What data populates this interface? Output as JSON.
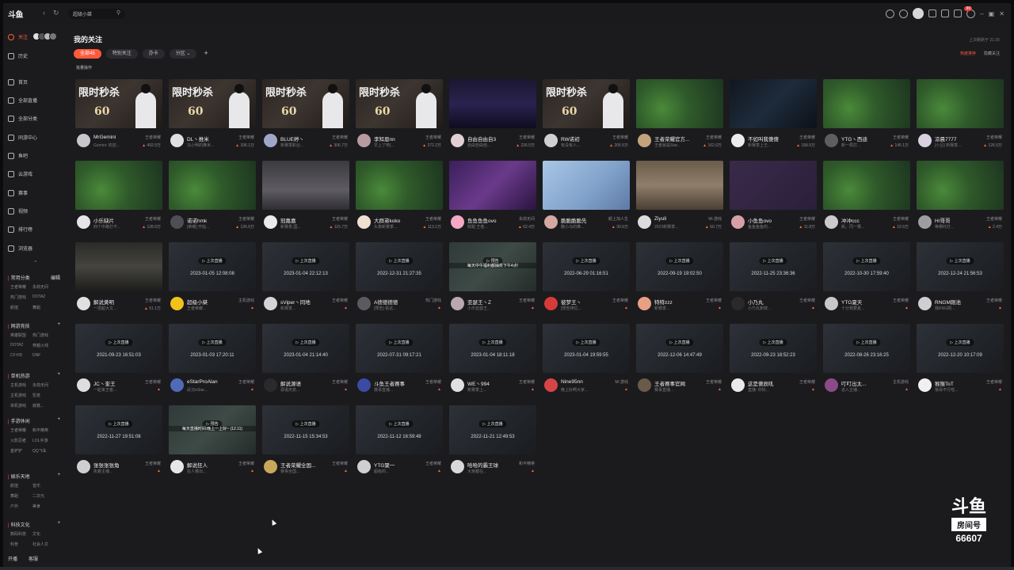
{
  "app": {
    "logo": "斗鱼",
    "search_value": "超级小桀",
    "notification_count": "99",
    "colors": {
      "accent": "#ff5a3c",
      "bg": "#1b1b1e",
      "card": "#2a2a2e"
    }
  },
  "sidebar": {
    "follow_label": "关注",
    "history_label": "历史",
    "nav": [
      "首页",
      "全部直播",
      "全部分类",
      "同游中心",
      "鱼吧",
      "云游戏",
      "赛事",
      "视频",
      "排行榜",
      "浏览器"
    ],
    "groups": [
      {
        "title": "常用分类",
        "action": "编辑",
        "items": [
          "王者荣耀",
          "永劫无间",
          "热门游戏",
          "DOTA2",
          "颜值",
          "舞蹈"
        ]
      },
      {
        "title": "网游竞技",
        "action": "+",
        "items": [
          "英雄联盟",
          "热门游戏",
          "DOTA2",
          "穿越火线",
          "CF:HD",
          "DNF"
        ]
      },
      {
        "title": "单机热游",
        "action": "+",
        "items": [
          "主机游戏",
          "永劫无间",
          "主机游戏",
          "饥荒",
          "单机游戏",
          "寂寞..."
        ]
      },
      {
        "title": "手游休闲",
        "action": "+",
        "items": [
          "王者荣耀",
          "和平精英",
          "火影忍者",
          "LOL手游",
          "金铲铲",
          "QQ飞车"
        ]
      },
      {
        "title": "娱乐天地",
        "action": "+",
        "items": [
          "颜值",
          "音乐",
          "舞蹈",
          "二次元",
          "户外",
          "美食"
        ]
      },
      {
        "title": "科技文化",
        "action": "+",
        "items": [
          "数码科技",
          "文化",
          "科普",
          "社会人文"
        ]
      }
    ],
    "bottom": [
      "开播",
      "客服"
    ]
  },
  "main": {
    "title": "我的关注",
    "tabs": [
      "全部45",
      "特别关注",
      "办卡",
      "分区"
    ],
    "batch_label": "批量操作",
    "updated": "上次刷新于 21:35",
    "link_hot": "热度排序",
    "link_hide": "隐藏关注",
    "promo_text": "限时秒杀",
    "promo_number": "60",
    "replay_label": "上次直播",
    "preview_label": "预告"
  },
  "cards": [
    {
      "name": "MrGemini",
      "cat": "王者荣耀",
      "sub": "Gemini: 欢迎...",
      "hot": "492.5万",
      "thumb": "promo",
      "av": "#c7c7cb"
    },
    {
      "name": "DL丶推米",
      "cat": "王者荣耀",
      "sub": "马小明的推米...",
      "hot": "336.1万",
      "thumb": "promo",
      "av": "#e0e0e2"
    },
    {
      "name": "BLUE婷丶",
      "cat": "王者荣耀",
      "sub": "新赛季职业...",
      "hot": "306.7万",
      "thumb": "promo",
      "av": "#9fa7c9"
    },
    {
      "name": "李知恩nn",
      "cat": "王者荣耀",
      "sub": "早上了吧(...",
      "hot": "272.2万",
      "thumb": "promo",
      "av": "#b89aa2"
    },
    {
      "name": "自由自由自3",
      "cat": "王者荣耀",
      "sub": "自由自由自...",
      "hot": "226.5万",
      "thumb": "game-dark",
      "av": "#e3cfd2"
    },
    {
      "name": "RW诺初",
      "cat": "王者荣耀",
      "sub": "有没有人...",
      "hot": "205.5万",
      "thumb": "promo",
      "av": "#d0d0d2"
    },
    {
      "name": "王者荣耀官方...",
      "cat": "王者荣耀",
      "sub": "王者就是Star...",
      "hot": "162.6万",
      "thumb": "moba",
      "av": "#c4a37c"
    },
    {
      "name": "不如叫我傻傻",
      "cat": "王者荣耀",
      "sub": "新赛季上王...",
      "hot": "158.5万",
      "thumb": "map",
      "av": "#ececec"
    },
    {
      "name": "YTG丶西迪",
      "cat": "王者荣耀",
      "sub": "新一局打...",
      "hot": "145.1万",
      "thumb": "moba",
      "av": "#5d5d62"
    },
    {
      "name": "凉晨7777",
      "cat": "王者荣耀",
      "sub": "[小吕] 新赛季...",
      "hot": "126.5万",
      "thumb": "moba",
      "av": "#d9d0e0"
    },
    {
      "name": "小乐缺片",
      "cat": "王者荣耀",
      "sub": "四个中路打不...",
      "hot": "128.6万",
      "thumb": "moba",
      "av": "#e5e5e7"
    },
    {
      "name": "诺诺hmk",
      "cat": "王者荣耀",
      "sub": "[荣耀] 开始...",
      "hot": "126.6万",
      "thumb": "moba",
      "av": "#4e4e55"
    },
    {
      "name": "冠嘉嘉",
      "cat": "王者荣耀",
      "sub": "新赛季,国...",
      "hot": "115.7万",
      "thumb": "desk",
      "av": "#eaeaea"
    },
    {
      "name": "大群弟koko",
      "cat": "王者荣耀",
      "sub": "头像新赛季...",
      "hot": "113.1万",
      "thumb": "moba",
      "av": "#f0e0d0"
    },
    {
      "name": "鱼鱼鱼鱼ovo",
      "cat": "永劫无间",
      "sub": "鲜甜 王者...",
      "hot": "62.4万",
      "thumb": "purple",
      "av": "#f5a7c4"
    },
    {
      "name": "脆脆脆脆先",
      "cat": "颜上加人生",
      "sub": "脆小马的推...",
      "hot": "30.6万",
      "thumb": "anime",
      "av": "#d6a8a2"
    },
    {
      "name": "Ziyuli",
      "cat": "Mi 游戏",
      "sub": "2023新赛季...",
      "hot": "50.7万",
      "thumb": "room",
      "av": "#dcdcdc"
    },
    {
      "name": "小鱼鱼ovo",
      "cat": "王者荣耀",
      "sub": "鱼鱼鱼鱼的...",
      "hot": "11.8万",
      "thumb": "grid",
      "av": "#d8a0a6"
    },
    {
      "name": "冲冲ccc",
      "cat": "王者荣耀",
      "sub": "新。同一赛...",
      "hot": "10.5万",
      "thumb": "moba",
      "av": "#cbcbcd"
    },
    {
      "name": "H/哥哥",
      "cat": "王者荣耀",
      "sub": "等哪吒打...",
      "hot": "2.4万",
      "thumb": "moba",
      "av": "#9d9da2"
    },
    {
      "name": "解说黄明",
      "cat": "王者荣耀",
      "sub": "一把超大文...",
      "hot": "51.1万",
      "thumb": "chess",
      "av": "#e0e0e0"
    },
    {
      "name": "超级小桀",
      "cat": "主机游戏",
      "sub": "王者荣耀...",
      "hot": "",
      "thumb": "replay",
      "ts": "2023-01-05 12:08:08",
      "av": "#f2c21b"
    },
    {
      "name": "sViper丶同地",
      "cat": "王者荣耀",
      "sub": "新赛季...",
      "hot": "",
      "thumb": "replay",
      "ts": "2023-01-04 22:12:13",
      "av": "#d4d4d6"
    },
    {
      "name": "A德德德德",
      "cat": "热门游戏",
      "sub": "[预告] 看这...",
      "hot": "",
      "thumb": "replay",
      "ts": "2022-12-31 21:27:35",
      "av": "#5a5a60"
    },
    {
      "name": "亚瑟王丶Z",
      "cat": "王者荣耀",
      "sub": "小乐亚瑟王...",
      "hot": "",
      "thumb": "preview",
      "ov": "每天中午福利都抽奖下午4点!",
      "av": "#b9a8b0"
    },
    {
      "name": "彼梦王丶",
      "cat": "王者荣耀",
      "sub": "[预告排位...",
      "hot": "",
      "thumb": "replay",
      "ts": "2022-06-29 01:16:51",
      "av": "#d83a3a"
    },
    {
      "name": "特特zzz",
      "cat": "王者荣耀",
      "sub": "新赛季...",
      "hot": "",
      "thumb": "replay",
      "ts": "2022-09-19 19:02:50",
      "av": "#e8a083"
    },
    {
      "name": "小乃丸",
      "cat": "王者荣耀",
      "sub": "小乃丸新鲜...",
      "hot": "",
      "thumb": "replay",
      "ts": "2022-11-25 23:36:36",
      "av": "#2a2a2a"
    },
    {
      "name": "YTG夏天",
      "cat": "王者荣耀",
      "sub": "十分我要夏...",
      "hot": "",
      "thumb": "replay",
      "ts": "2022-10-30 17:59:40",
      "av": "#c8c8ca"
    },
    {
      "name": "RNGM刚池",
      "cat": "王者荣耀",
      "sub": "我RNG刚...",
      "hot": "",
      "thumb": "replay",
      "ts": "2022-12-24 21:56:53",
      "av": "#cfcfd2"
    },
    {
      "name": "JC丶奎王",
      "cat": "王者荣耀",
      "sub": "一起来王者...",
      "hot": "",
      "thumb": "replay",
      "ts": "2021-09-23 16:51:03",
      "av": "#dedee0"
    },
    {
      "name": "eStarProAlan",
      "cat": "王者荣耀",
      "sub": "武汉eStar...",
      "hot": "",
      "thumb": "replay",
      "ts": "2023-01-03 17:20:11",
      "av": "#4f6bb8"
    },
    {
      "name": "解说源语",
      "cat": "王者荣耀",
      "sub": "源语天泉...",
      "hot": "",
      "thumb": "replay",
      "ts": "2023-01-04 21:14:40",
      "av": "#2a2a2e"
    },
    {
      "name": "斗鱼王者赛事",
      "cat": "王者荣耀",
      "sub": "赛事直播...",
      "hot": "",
      "thumb": "replay",
      "ts": "2022-07-31 09:17:21",
      "av": "#3c4aa3"
    },
    {
      "name": "WE丶994",
      "cat": "王者荣耀",
      "sub": "新赛季上...",
      "hot": "",
      "thumb": "replay",
      "ts": "2023-01-04 18:11:18",
      "av": "#e0e0e2"
    },
    {
      "name": "Nine95nn",
      "cat": "Mi 游戏",
      "sub": "晚上好啊大家...",
      "hot": "",
      "thumb": "replay",
      "ts": "2023-01-04 19:59:55",
      "av": "#d64545"
    },
    {
      "name": "王者赛事官网",
      "cat": "王者荣耀",
      "sub": "赛事直播...",
      "hot": "",
      "thumb": "replay",
      "ts": "2022-12-06 14:47:49",
      "av": "#6a5a4a"
    },
    {
      "name": "这是傻辰吼",
      "cat": "王者荣耀",
      "sub": "直播: 你好...",
      "hot": "",
      "thumb": "replay",
      "ts": "2022-09-23 18:52:23",
      "av": "#eaeaea"
    },
    {
      "name": "叮叮出太...",
      "cat": "主机游戏",
      "sub": "进入主播...",
      "hot": "",
      "thumb": "replay",
      "ts": "2022-08-26 23:16:25",
      "av": "#8d4a8a"
    },
    {
      "name": "猴猴ToT",
      "cat": "王者荣耀",
      "sub": "猴哥不行啦...",
      "hot": "",
      "thumb": "replay",
      "ts": "2022-12-20 10:17:09",
      "av": "#f0f0f0"
    },
    {
      "name": "张张张张角",
      "cat": "王者荣耀",
      "sub": "执着主播...",
      "hot": "",
      "thumb": "replay",
      "ts": "2022-11-27 19:51:08",
      "av": "#cfcfd2"
    },
    {
      "name": "解说狂人",
      "cat": "王者荣耀",
      "sub": "狂人赛出...",
      "hot": "",
      "thumb": "preview",
      "ov": "每天直播时间:晚上一上好~ (12.11)",
      "av": "#e6e6e8"
    },
    {
      "name": "王者荣耀全国...",
      "cat": "王者荣耀",
      "sub": "赛事全国...",
      "hot": "",
      "thumb": "replay",
      "ts": "2022-11-15 15:34:53",
      "av": "#c9a85a"
    },
    {
      "name": "YTG聚一",
      "cat": "王者荣耀",
      "sub": "超级的...",
      "hot": "",
      "thumb": "replay",
      "ts": "2022-11-12 16:59:49",
      "av": "#cfcfd2"
    },
    {
      "name": "哈哈的霸王球",
      "cat": "和平精英",
      "sub": "大家都在...",
      "hot": "",
      "thumb": "replay",
      "ts": "2022-11-21 12:49:53",
      "av": "#d8d8da"
    }
  ],
  "room_badge": {
    "line1": "斗鱼",
    "line2": "房间号",
    "number": "66607"
  }
}
